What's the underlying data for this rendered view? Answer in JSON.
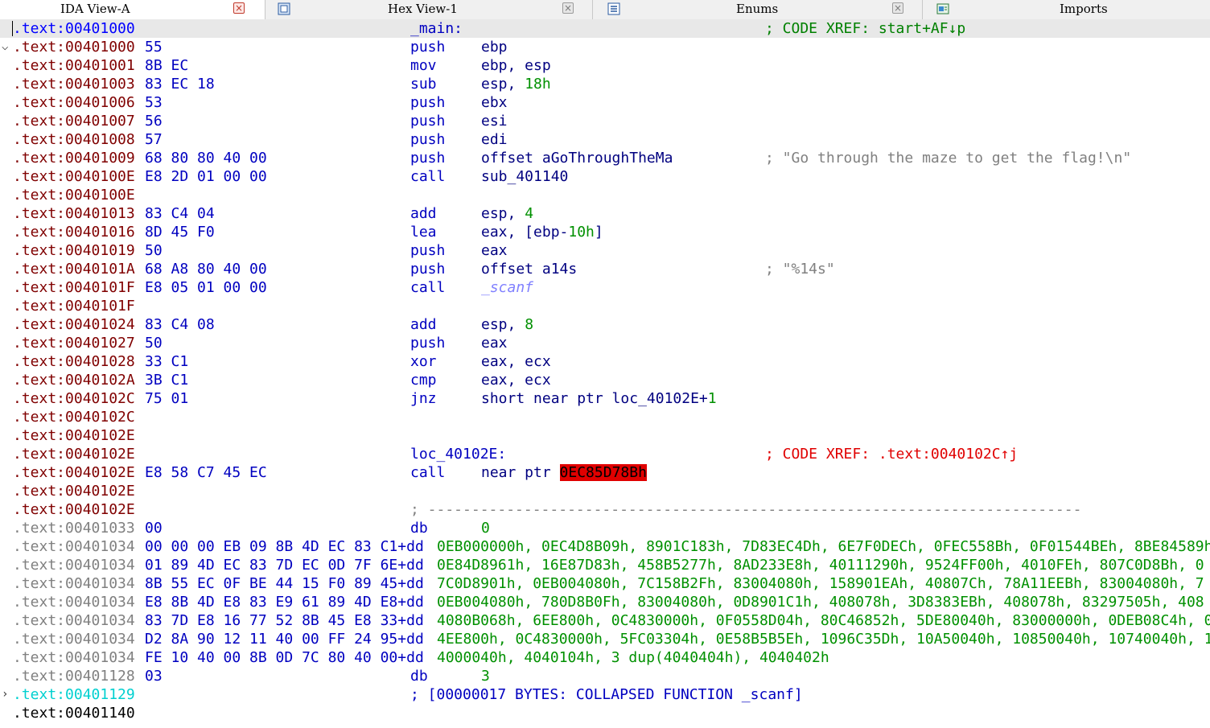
{
  "tabs": [
    {
      "label": "IDA View-A",
      "icon": "none",
      "close": "red",
      "active": true
    },
    {
      "label": "Hex View-1",
      "icon": "hex-view-icon",
      "close": "gray",
      "active": false
    },
    {
      "label": "Enums",
      "icon": "enums-icon",
      "close": "gray",
      "active": false
    },
    {
      "label": "Imports",
      "icon": "imports-icon",
      "close": "none",
      "active": false
    }
  ],
  "colors": {
    "code_addr": "#0000ff",
    "data_addr": "#800000",
    "unexplored_addr": "#808080",
    "selected_addr": "#00d0d0",
    "bytes": "#0000c0",
    "mnemonic": "#0000c0",
    "number": "#009000",
    "comment": "#008000",
    "xref_comment_red": "#e00000",
    "error_highlight": "#e00000"
  },
  "listing": [
    {
      "addr": ".text:00401000",
      "ac": "code",
      "bytes": "",
      "mn": "_main:",
      "op": [],
      "cm": "; CODE XREF: start+AF↓p",
      "cmc": "green",
      "highlight": true,
      "caret": true
    },
    {
      "gutter": "⌵",
      "addr": ".text:00401000",
      "ac": "data",
      "bytes": "55",
      "mn": "push",
      "op": [
        {
          "t": "ebp"
        }
      ]
    },
    {
      "addr": ".text:00401001",
      "ac": "data",
      "bytes": "8B EC",
      "mn": "mov",
      "op": [
        {
          "t": "ebp, esp"
        }
      ]
    },
    {
      "addr": ".text:00401003",
      "ac": "data",
      "bytes": "83 EC 18",
      "mn": "sub",
      "op": [
        {
          "t": "esp, "
        },
        {
          "t": "18h",
          "k": "num"
        }
      ]
    },
    {
      "addr": ".text:00401006",
      "ac": "data",
      "bytes": "53",
      "mn": "push",
      "op": [
        {
          "t": "ebx"
        }
      ]
    },
    {
      "addr": ".text:00401007",
      "ac": "data",
      "bytes": "56",
      "mn": "push",
      "op": [
        {
          "t": "esi"
        }
      ]
    },
    {
      "addr": ".text:00401008",
      "ac": "data",
      "bytes": "57",
      "mn": "push",
      "op": [
        {
          "t": "edi"
        }
      ]
    },
    {
      "addr": ".text:00401009",
      "ac": "data",
      "bytes": "68 80 80 40 00",
      "mn": "push",
      "op": [
        {
          "t": "offset aGoThroughTheMa"
        }
      ],
      "cm": "; \"Go through the maze to get the flag!\\n\"",
      "cmc": "gray"
    },
    {
      "addr": ".text:0040100E",
      "ac": "data",
      "bytes": "E8 2D 01 00 00",
      "mn": "call",
      "op": [
        {
          "t": "sub_401140"
        }
      ]
    },
    {
      "addr": ".text:0040100E",
      "ac": "data"
    },
    {
      "addr": ".text:00401013",
      "ac": "data",
      "bytes": "83 C4 04",
      "mn": "add",
      "op": [
        {
          "t": "esp, "
        },
        {
          "t": "4",
          "k": "num"
        }
      ]
    },
    {
      "addr": ".text:00401016",
      "ac": "data",
      "bytes": "8D 45 F0",
      "mn": "lea",
      "op": [
        {
          "t": "eax, [ebp-"
        },
        {
          "t": "10h",
          "k": "num"
        },
        {
          "t": "]"
        }
      ]
    },
    {
      "addr": ".text:00401019",
      "ac": "data",
      "bytes": "50",
      "mn": "push",
      "op": [
        {
          "t": "eax"
        }
      ]
    },
    {
      "addr": ".text:0040101A",
      "ac": "data",
      "bytes": "68 A8 80 40 00",
      "mn": "push",
      "op": [
        {
          "t": "offset a14s"
        }
      ],
      "cm": "; \"%14s\"",
      "cmc": "gray"
    },
    {
      "addr": ".text:0040101F",
      "ac": "data",
      "bytes": "E8 05 01 00 00",
      "mn": "call",
      "op": [
        {
          "t": "_scanf",
          "k": "dim"
        }
      ]
    },
    {
      "addr": ".text:0040101F",
      "ac": "data"
    },
    {
      "addr": ".text:00401024",
      "ac": "data",
      "bytes": "83 C4 08",
      "mn": "add",
      "op": [
        {
          "t": "esp, "
        },
        {
          "t": "8",
          "k": "num"
        }
      ]
    },
    {
      "addr": ".text:00401027",
      "ac": "data",
      "bytes": "50",
      "mn": "push",
      "op": [
        {
          "t": "eax"
        }
      ]
    },
    {
      "addr": ".text:00401028",
      "ac": "data",
      "bytes": "33 C1",
      "mn": "xor",
      "op": [
        {
          "t": "eax, ecx"
        }
      ]
    },
    {
      "addr": ".text:0040102A",
      "ac": "data",
      "bytes": "3B C1",
      "mn": "cmp",
      "op": [
        {
          "t": "eax, ecx"
        }
      ]
    },
    {
      "addr": ".text:0040102C",
      "ac": "data",
      "bytes": "75 01",
      "mn": "jnz",
      "op": [
        {
          "t": "short near ptr loc_40102E+"
        },
        {
          "t": "1",
          "k": "num"
        }
      ]
    },
    {
      "addr": ".text:0040102C",
      "ac": "data"
    },
    {
      "addr": ".text:0040102E",
      "ac": "data"
    },
    {
      "addr": ".text:0040102E",
      "ac": "data",
      "bytes": "",
      "mn": "loc_40102E:",
      "op": [],
      "cm": "; CODE XREF: .text:0040102C↑j",
      "cmc": "red"
    },
    {
      "addr": ".text:0040102E",
      "ac": "data",
      "bytes": "E8 58 C7 45 EC",
      "mn": "call",
      "op": [
        {
          "t": "near ptr "
        },
        {
          "t": "0EC85D78Bh",
          "k": "bad"
        }
      ]
    },
    {
      "addr": ".text:0040102E",
      "ac": "data"
    },
    {
      "addr": ".text:0040102E",
      "ac": "data",
      "bytes": "",
      "mn": "; ---------------------------------------------------------------------------",
      "mnc": "sep",
      "op": []
    },
    {
      "addr": ".text:00401033",
      "ac": "gray",
      "bytes": "00",
      "mn": "db",
      "op": [
        {
          "t": "0",
          "k": "num"
        }
      ]
    },
    {
      "addr": ".text:00401034",
      "ac": "gray",
      "bytes": "00 00 00 EB 09 8B 4D EC 83 C1+dd",
      "mn": "",
      "op": [],
      "tail": "0EB000000h, 0EC4D8B09h, 8901C183h, 7D83EC4Dh, 6E7F0DECh, 0FEC558Bh, 0F01544BEh, 8BE84589h"
    },
    {
      "addr": ".text:00401034",
      "ac": "gray",
      "bytes": "01 89 4D EC 83 7D EC 0D 7F 6E+dd",
      "mn": "",
      "op": [],
      "tail": "0E84D8961h, 16E87D83h, 458B5277h, 8AD233E8h, 40111290h, 9524FF00h, 4010FEh, 807C0D8Bh, 0"
    },
    {
      "addr": ".text:00401034",
      "ac": "gray",
      "bytes": "8B 55 EC 0F BE 44 15 F0 89 45+dd",
      "mn": "",
      "op": [],
      "tail": "7C0D8901h, 0EB004080h, 7C158B2Fh, 83004080h, 158901EAh, 40807Ch, 78A11EEBh, 83004080h, 7"
    },
    {
      "addr": ".text:00401034",
      "ac": "gray",
      "bytes": "E8 8B 4D E8 83 E9 61 89 4D E8+dd",
      "mn": "",
      "op": [],
      "tail": "0EB004080h, 780D8B0Fh, 83004080h, 0D8901C1h, 408078h, 3D8383EBh, 408078h, 83297505h, 408"
    },
    {
      "addr": ".text:00401034",
      "ac": "gray",
      "bytes": "83 7D E8 16 77 52 8B 45 E8 33+dd",
      "mn": "",
      "op": [],
      "tail": "4080B068h, 6EE800h, 0C4830000h, 0F0558D04h, 80C46852h, 5DE80040h, 83000000h, 0DEB08C4h, 0"
    },
    {
      "addr": ".text:00401034",
      "ac": "gray",
      "bytes": "D2 8A 90 12 11 40 00 FF 24 95+dd",
      "mn": "",
      "op": [],
      "tail": "4EE800h, 0C4830000h, 5FC03304h, 0E58B5B5Eh, 1096C35Dh, 10A50040h, 10850040h, 10740040h, 1"
    },
    {
      "addr": ".text:00401034",
      "ac": "gray",
      "bytes": "FE 10 40 00 8B 0D 7C 80 40 00+dd",
      "mn": "",
      "op": [],
      "tail": "4000040h, 4040104h, 3 dup(4040404h), 4040402h"
    },
    {
      "addr": ".text:00401128",
      "ac": "gray",
      "bytes": "03",
      "mn": "db",
      "op": [
        {
          "t": "3",
          "k": "num"
        }
      ]
    },
    {
      "gutter": "›",
      "addr": ".text:00401129",
      "ac": "cyan",
      "bytes": "",
      "mn": "; [00000017 BYTES: COLLAPSED FUNCTION _scanf]",
      "mnc": "blue",
      "op": []
    },
    {
      "addr": ".text:00401140",
      "ac": "black"
    }
  ]
}
